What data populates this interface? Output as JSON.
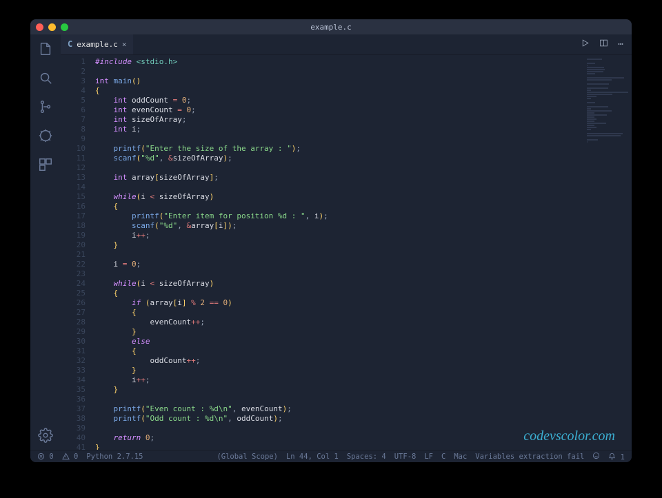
{
  "window": {
    "title": "example.c"
  },
  "tab": {
    "label": "example.c"
  },
  "watermark": "codevscolor.com",
  "statusbar": {
    "errors": "0",
    "warnings": "0",
    "python": "Python 2.7.15",
    "scope": "(Global Scope)",
    "cursor": "Ln 44, Col 1",
    "spaces": "Spaces: 4",
    "encoding": "UTF-8",
    "eol": "LF",
    "lang": "C",
    "os": "Mac",
    "extract": "Variables extraction fail",
    "notif": "1"
  },
  "code": [
    [
      {
        "c": "inc",
        "t": "#include"
      },
      {
        "c": "",
        "t": " "
      },
      {
        "c": "hdr",
        "t": "<stdio.h>"
      }
    ],
    [],
    [
      {
        "c": "ty",
        "t": "int"
      },
      {
        "c": "",
        "t": " "
      },
      {
        "c": "fn",
        "t": "main"
      },
      {
        "c": "brace",
        "t": "()"
      }
    ],
    [
      {
        "c": "brace",
        "t": "{"
      }
    ],
    [
      {
        "c": "",
        "t": "    "
      },
      {
        "c": "ty",
        "t": "int"
      },
      {
        "c": "",
        "t": " oddCount "
      },
      {
        "c": "op",
        "t": "="
      },
      {
        "c": "",
        "t": " "
      },
      {
        "c": "num",
        "t": "0"
      },
      {
        "c": "pun",
        "t": ";"
      }
    ],
    [
      {
        "c": "",
        "t": "    "
      },
      {
        "c": "ty",
        "t": "int"
      },
      {
        "c": "",
        "t": " evenCount "
      },
      {
        "c": "op",
        "t": "="
      },
      {
        "c": "",
        "t": " "
      },
      {
        "c": "num",
        "t": "0"
      },
      {
        "c": "pun",
        "t": ";"
      }
    ],
    [
      {
        "c": "",
        "t": "    "
      },
      {
        "c": "ty",
        "t": "int"
      },
      {
        "c": "",
        "t": " sizeOfArray"
      },
      {
        "c": "pun",
        "t": ";"
      }
    ],
    [
      {
        "c": "",
        "t": "    "
      },
      {
        "c": "ty",
        "t": "int"
      },
      {
        "c": "",
        "t": " i"
      },
      {
        "c": "pun",
        "t": ";"
      }
    ],
    [],
    [
      {
        "c": "",
        "t": "    "
      },
      {
        "c": "fn",
        "t": "printf"
      },
      {
        "c": "brace",
        "t": "("
      },
      {
        "c": "str",
        "t": "\"Enter the size of the array : \""
      },
      {
        "c": "brace",
        "t": ")"
      },
      {
        "c": "pun",
        "t": ";"
      }
    ],
    [
      {
        "c": "",
        "t": "    "
      },
      {
        "c": "fn",
        "t": "scanf"
      },
      {
        "c": "brace",
        "t": "("
      },
      {
        "c": "str",
        "t": "\"%d\""
      },
      {
        "c": "pun",
        "t": ", "
      },
      {
        "c": "op",
        "t": "&"
      },
      {
        "c": "",
        "t": "sizeOfArray"
      },
      {
        "c": "brace",
        "t": ")"
      },
      {
        "c": "pun",
        "t": ";"
      }
    ],
    [],
    [
      {
        "c": "",
        "t": "    "
      },
      {
        "c": "ty",
        "t": "int"
      },
      {
        "c": "",
        "t": " array"
      },
      {
        "c": "brace",
        "t": "["
      },
      {
        "c": "",
        "t": "sizeOfArray"
      },
      {
        "c": "brace",
        "t": "]"
      },
      {
        "c": "pun",
        "t": ";"
      }
    ],
    [],
    [
      {
        "c": "",
        "t": "    "
      },
      {
        "c": "kw",
        "t": "while"
      },
      {
        "c": "brace",
        "t": "("
      },
      {
        "c": "",
        "t": "i "
      },
      {
        "c": "op",
        "t": "<"
      },
      {
        "c": "",
        "t": " sizeOfArray"
      },
      {
        "c": "brace",
        "t": ")"
      }
    ],
    [
      {
        "c": "",
        "t": "    "
      },
      {
        "c": "brace",
        "t": "{"
      }
    ],
    [
      {
        "c": "",
        "t": "        "
      },
      {
        "c": "fn",
        "t": "printf"
      },
      {
        "c": "brace",
        "t": "("
      },
      {
        "c": "str",
        "t": "\"Enter item for position %d : \""
      },
      {
        "c": "pun",
        "t": ", "
      },
      {
        "c": "",
        "t": "i"
      },
      {
        "c": "brace",
        "t": ")"
      },
      {
        "c": "pun",
        "t": ";"
      }
    ],
    [
      {
        "c": "",
        "t": "        "
      },
      {
        "c": "fn",
        "t": "scanf"
      },
      {
        "c": "brace",
        "t": "("
      },
      {
        "c": "str",
        "t": "\"%d\""
      },
      {
        "c": "pun",
        "t": ", "
      },
      {
        "c": "op",
        "t": "&"
      },
      {
        "c": "",
        "t": "array"
      },
      {
        "c": "brace",
        "t": "["
      },
      {
        "c": "",
        "t": "i"
      },
      {
        "c": "brace",
        "t": "])"
      },
      {
        "c": "pun",
        "t": ";"
      }
    ],
    [
      {
        "c": "",
        "t": "        i"
      },
      {
        "c": "op",
        "t": "++"
      },
      {
        "c": "pun",
        "t": ";"
      }
    ],
    [
      {
        "c": "",
        "t": "    "
      },
      {
        "c": "brace",
        "t": "}"
      }
    ],
    [],
    [
      {
        "c": "",
        "t": "    i "
      },
      {
        "c": "op",
        "t": "="
      },
      {
        "c": "",
        "t": " "
      },
      {
        "c": "num",
        "t": "0"
      },
      {
        "c": "pun",
        "t": ";"
      }
    ],
    [],
    [
      {
        "c": "",
        "t": "    "
      },
      {
        "c": "kw",
        "t": "while"
      },
      {
        "c": "brace",
        "t": "("
      },
      {
        "c": "",
        "t": "i "
      },
      {
        "c": "op",
        "t": "<"
      },
      {
        "c": "",
        "t": " sizeOfArray"
      },
      {
        "c": "brace",
        "t": ")"
      }
    ],
    [
      {
        "c": "",
        "t": "    "
      },
      {
        "c": "brace",
        "t": "{"
      }
    ],
    [
      {
        "c": "",
        "t": "        "
      },
      {
        "c": "kw",
        "t": "if"
      },
      {
        "c": "",
        "t": " "
      },
      {
        "c": "brace",
        "t": "("
      },
      {
        "c": "",
        "t": "array"
      },
      {
        "c": "brace",
        "t": "["
      },
      {
        "c": "",
        "t": "i"
      },
      {
        "c": "brace",
        "t": "]"
      },
      {
        "c": "",
        "t": " "
      },
      {
        "c": "op",
        "t": "%"
      },
      {
        "c": "",
        "t": " "
      },
      {
        "c": "num",
        "t": "2"
      },
      {
        "c": "",
        "t": " "
      },
      {
        "c": "op",
        "t": "=="
      },
      {
        "c": "",
        "t": " "
      },
      {
        "c": "num",
        "t": "0"
      },
      {
        "c": "brace",
        "t": ")"
      }
    ],
    [
      {
        "c": "",
        "t": "        "
      },
      {
        "c": "brace",
        "t": "{"
      }
    ],
    [
      {
        "c": "",
        "t": "            evenCount"
      },
      {
        "c": "op",
        "t": "++"
      },
      {
        "c": "pun",
        "t": ";"
      }
    ],
    [
      {
        "c": "",
        "t": "        "
      },
      {
        "c": "brace",
        "t": "}"
      }
    ],
    [
      {
        "c": "",
        "t": "        "
      },
      {
        "c": "kw",
        "t": "else"
      }
    ],
    [
      {
        "c": "",
        "t": "        "
      },
      {
        "c": "brace",
        "t": "{"
      }
    ],
    [
      {
        "c": "",
        "t": "            oddCount"
      },
      {
        "c": "op",
        "t": "++"
      },
      {
        "c": "pun",
        "t": ";"
      }
    ],
    [
      {
        "c": "",
        "t": "        "
      },
      {
        "c": "brace",
        "t": "}"
      }
    ],
    [
      {
        "c": "",
        "t": "        i"
      },
      {
        "c": "op",
        "t": "++"
      },
      {
        "c": "pun",
        "t": ";"
      }
    ],
    [
      {
        "c": "",
        "t": "    "
      },
      {
        "c": "brace",
        "t": "}"
      }
    ],
    [],
    [
      {
        "c": "",
        "t": "    "
      },
      {
        "c": "fn",
        "t": "printf"
      },
      {
        "c": "brace",
        "t": "("
      },
      {
        "c": "str",
        "t": "\"Even count : %d\\n\""
      },
      {
        "c": "pun",
        "t": ", "
      },
      {
        "c": "",
        "t": "evenCount"
      },
      {
        "c": "brace",
        "t": ")"
      },
      {
        "c": "pun",
        "t": ";"
      }
    ],
    [
      {
        "c": "",
        "t": "    "
      },
      {
        "c": "fn",
        "t": "printf"
      },
      {
        "c": "brace",
        "t": "("
      },
      {
        "c": "str",
        "t": "\"Odd count : %d\\n\""
      },
      {
        "c": "pun",
        "t": ", "
      },
      {
        "c": "",
        "t": "oddCount"
      },
      {
        "c": "brace",
        "t": ")"
      },
      {
        "c": "pun",
        "t": ";"
      }
    ],
    [],
    [
      {
        "c": "",
        "t": "    "
      },
      {
        "c": "kw",
        "t": "return"
      },
      {
        "c": "",
        "t": " "
      },
      {
        "c": "num",
        "t": "0"
      },
      {
        "c": "pun",
        "t": ";"
      }
    ],
    [
      {
        "c": "brace",
        "t": "}"
      }
    ]
  ]
}
